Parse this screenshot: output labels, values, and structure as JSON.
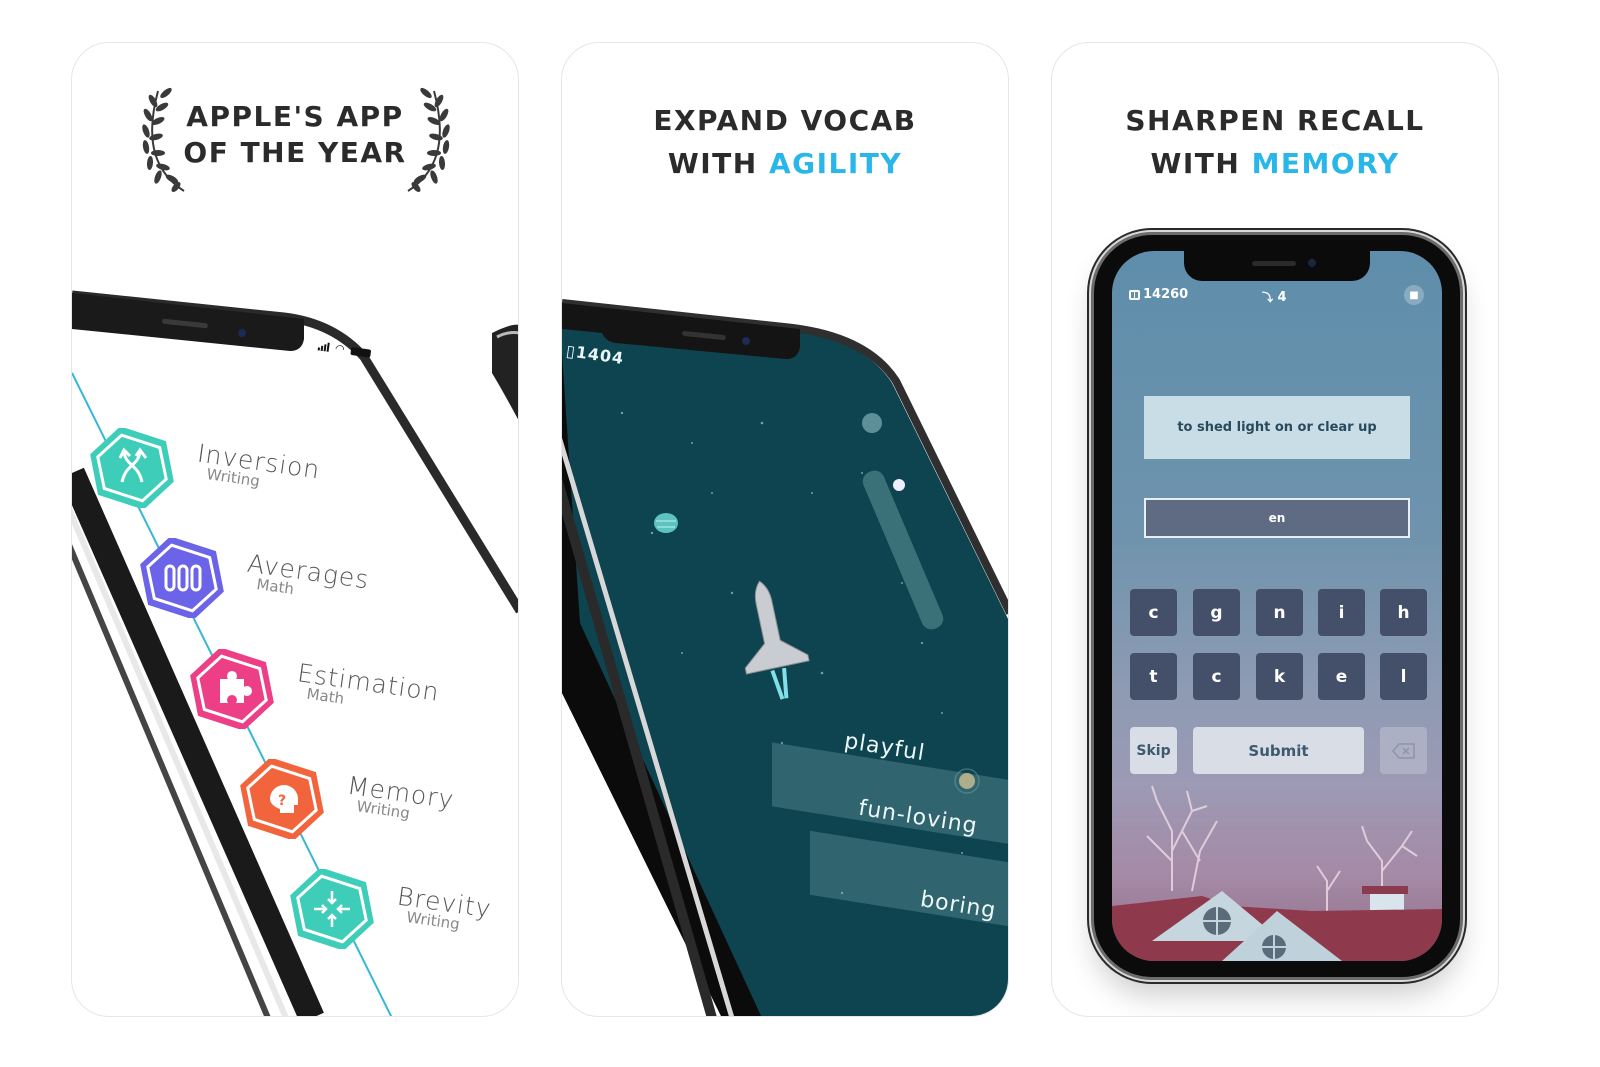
{
  "cards": [
    {
      "headline_line1": "APPLE'S APP",
      "headline_line2": "OF THE YEAR",
      "status_bar": {
        "signal": "signal-icon",
        "wifi": "wifi-icon",
        "battery": "battery-icon"
      },
      "skills": [
        {
          "name": "Inversion",
          "category": "Writing",
          "color": "#3ecdb9",
          "icon": "inversion-arrows-icon"
        },
        {
          "name": "Averages",
          "category": "Math",
          "color": "#6b63e8",
          "icon": "averages-bars-icon"
        },
        {
          "name": "Estimation",
          "category": "Math",
          "color": "#ec3f86",
          "icon": "puzzle-piece-icon"
        },
        {
          "name": "Memory",
          "category": "Writing",
          "color": "#f2643c",
          "icon": "head-question-icon"
        },
        {
          "name": "Brevity",
          "category": "Writing",
          "color": "#3ecdb9",
          "icon": "converge-arrows-icon"
        }
      ]
    },
    {
      "headline_line1": "EXPAND VOCAB",
      "headline_line2_prefix": "WITH ",
      "headline_line2_accent": "AGILITY",
      "score": "1404",
      "prompt_word": "playful",
      "options": [
        "fun-loving",
        "boring"
      ]
    },
    {
      "headline_line1": "SHARPEN RECALL",
      "headline_line2_prefix": "WITH ",
      "headline_line2_accent": "MEMORY",
      "coins": "14260",
      "birds": "4",
      "definition": "to shed light on or clear up",
      "answer_value": "en",
      "keys_row1": [
        "c",
        "g",
        "n",
        "i",
        "h"
      ],
      "keys_row2": [
        "t",
        "c",
        "k",
        "e",
        "l"
      ],
      "skip_label": "Skip",
      "submit_label": "Submit"
    }
  ],
  "colors": {
    "accent": "#29b6e8",
    "headline": "#2b2b2b",
    "space_bg": "#0e4350",
    "key_bg": "#44506a"
  }
}
